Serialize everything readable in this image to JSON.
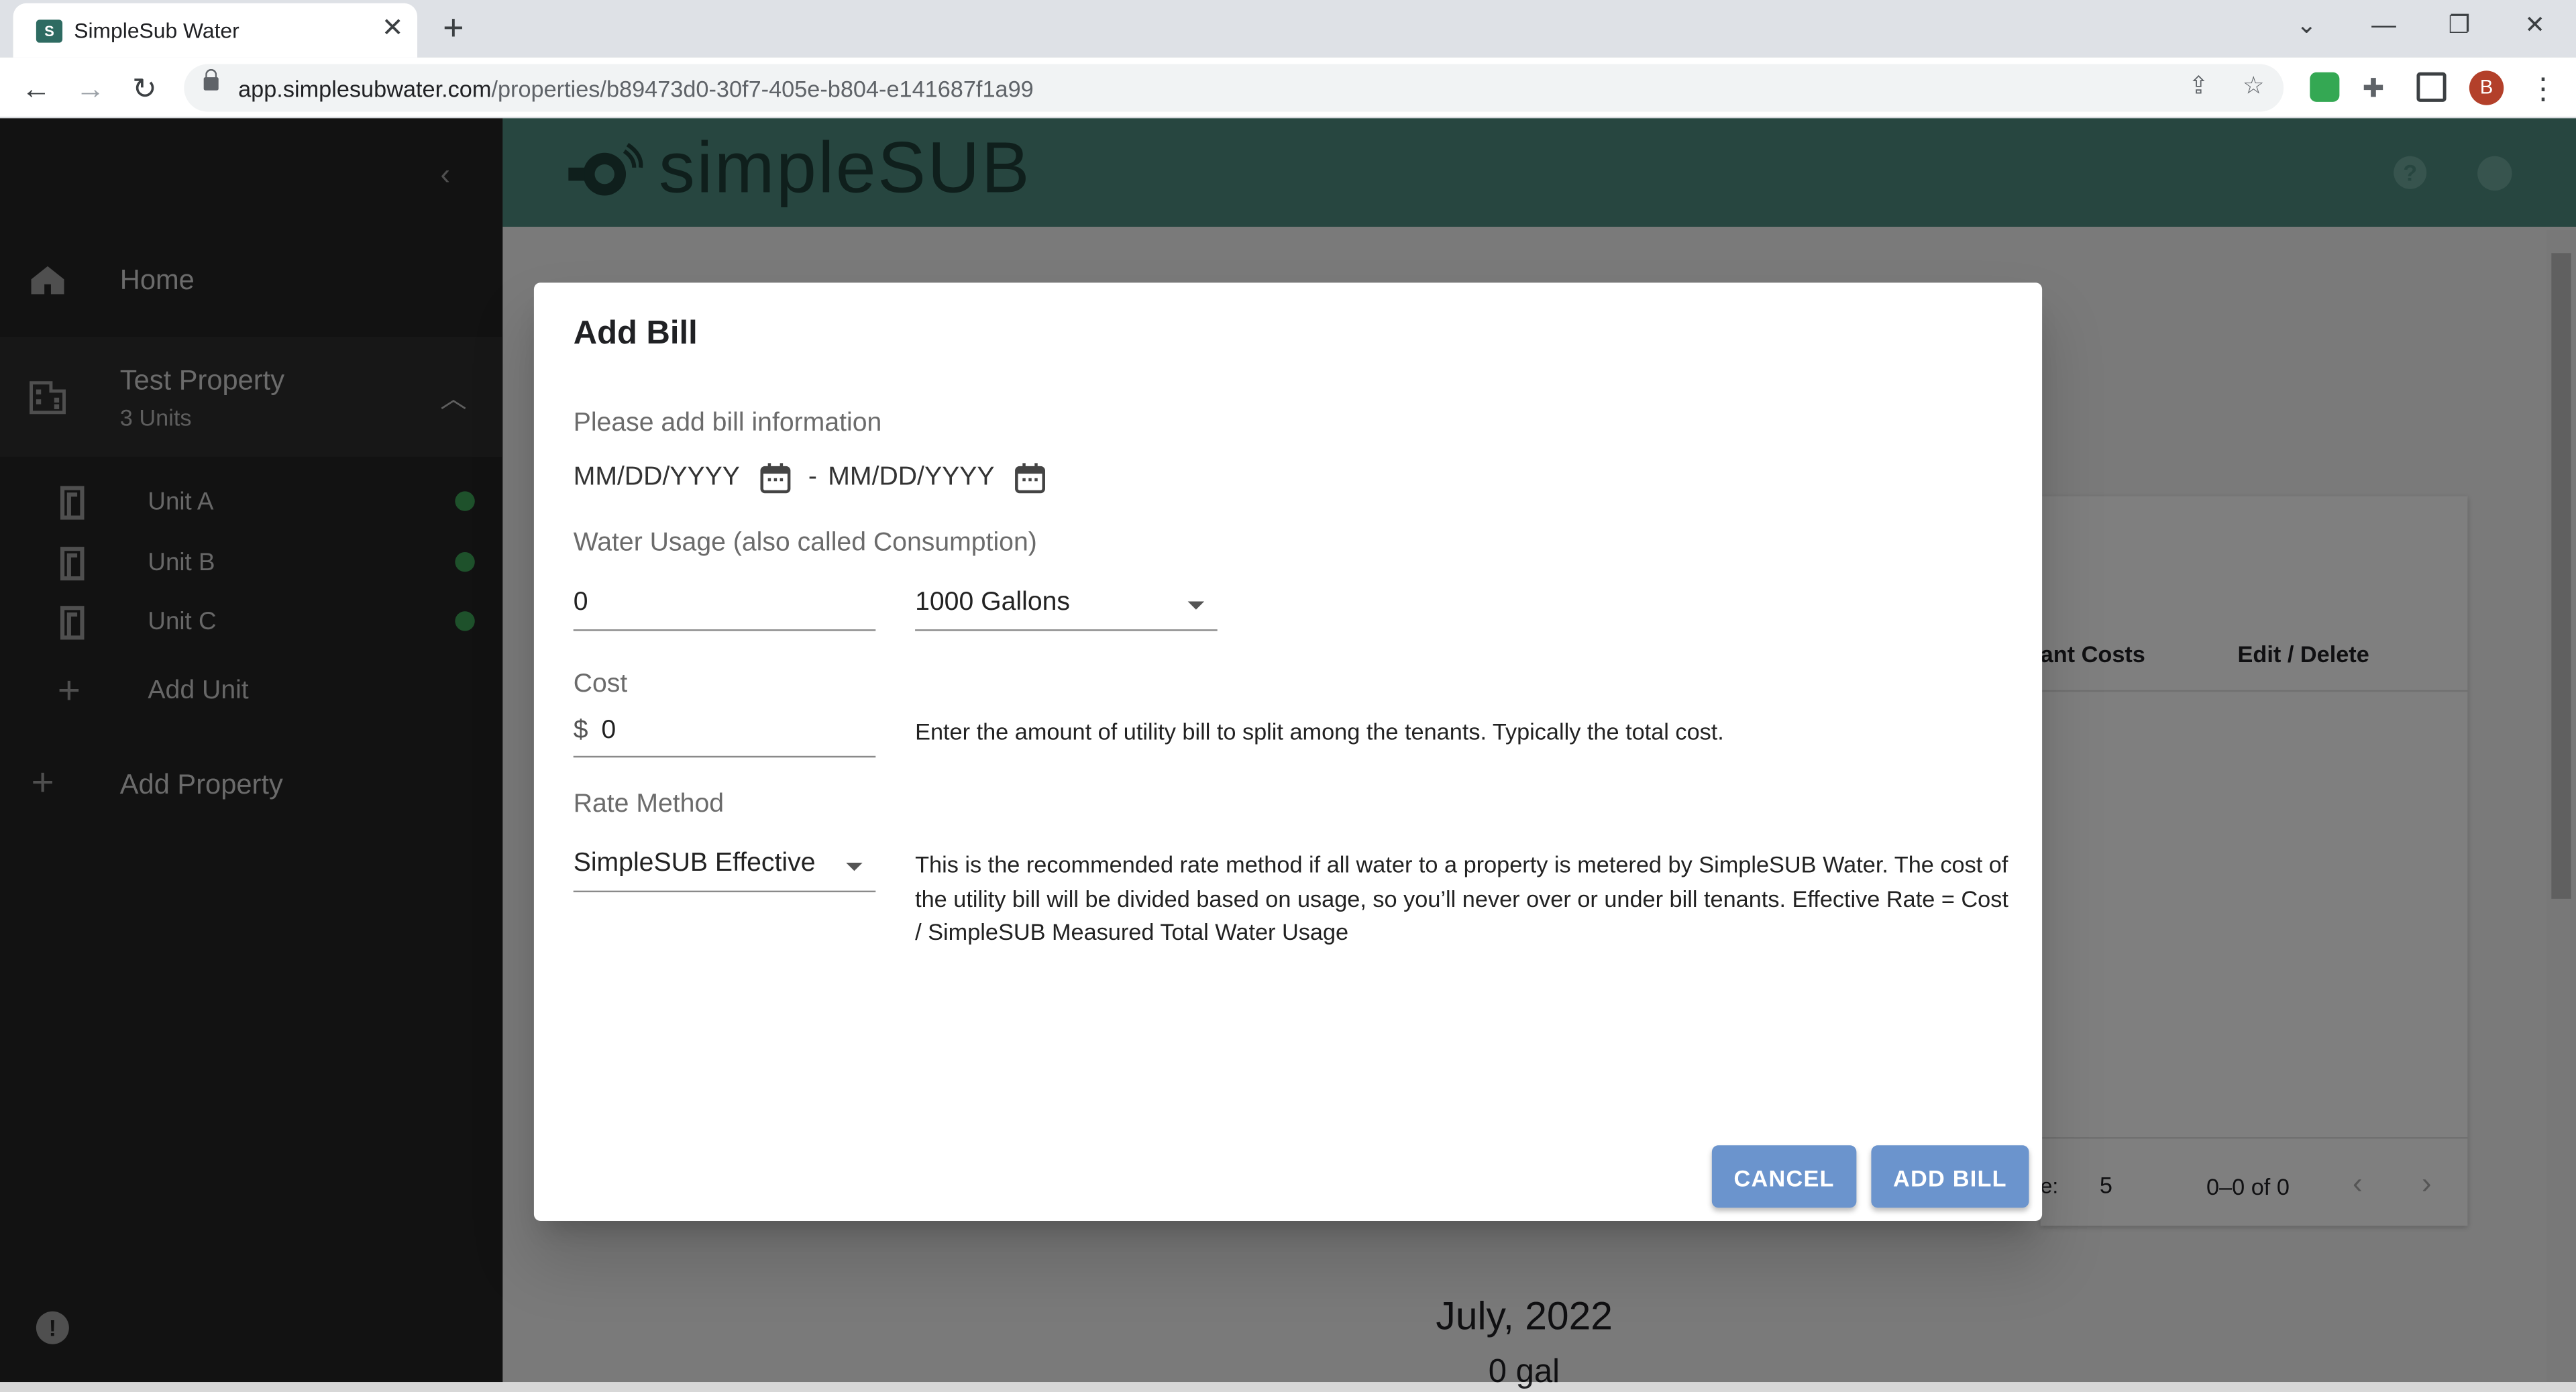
{
  "browser": {
    "tab_title": "SimpleSub Water",
    "url_host": "app.simplesubwater.com",
    "url_path": "/properties/b89473d0-30f7-405e-b804-e141687f1a99",
    "profile_initial": "B"
  },
  "app": {
    "logo_text": "simpleSUB"
  },
  "sidebar": {
    "home_label": "Home",
    "property": {
      "name": "Test Property",
      "units_count": "3 Units"
    },
    "units": [
      {
        "label": "Unit A",
        "status_color": "#3da356"
      },
      {
        "label": "Unit B",
        "status_color": "#3da356"
      },
      {
        "label": "Unit C",
        "status_color": "#3da356"
      }
    ],
    "add_unit_label": "Add Unit",
    "add_property_label": "Add Property"
  },
  "background": {
    "col_tenant_costs": "ant Costs",
    "col_edit_delete": "Edit / Delete",
    "rows_label": "e:",
    "rows_per_page": "5",
    "pagination": "0–0 of 0",
    "month": "July, 2022",
    "usage": "0 gal"
  },
  "dialog": {
    "title": "Add Bill",
    "intro": "Please add bill information",
    "start_date_placeholder": "MM/DD/YYYY",
    "date_separator": "-",
    "end_date_placeholder": "MM/DD/YYYY",
    "usage_label": "Water Usage (also called Consumption)",
    "usage_value": "0",
    "usage_unit": "1000 Gallons",
    "cost_label": "Cost",
    "cost_prefix": "$",
    "cost_value": "0",
    "cost_helper": "Enter the amount of utility bill to split among the tenants. Typically the total cost.",
    "rate_label": "Rate Method",
    "rate_value": "SimpleSUB Effective",
    "rate_helper": "This is the recommended rate method if all water to a property is metered by SimpleSUB Water. The cost of the utility bill will be divided based on usage, so you’ll never over or under bill tenants. Effective Rate = Cost / SimpleSUB Measured Total Water Usage",
    "cancel_label": "CANCEL",
    "submit_label": "ADD BILL"
  },
  "colors": {
    "header_teal": "#4e8c80",
    "sidebar_bg": "#252525",
    "button_blue": "#6b94cd",
    "status_green": "#3da356"
  }
}
